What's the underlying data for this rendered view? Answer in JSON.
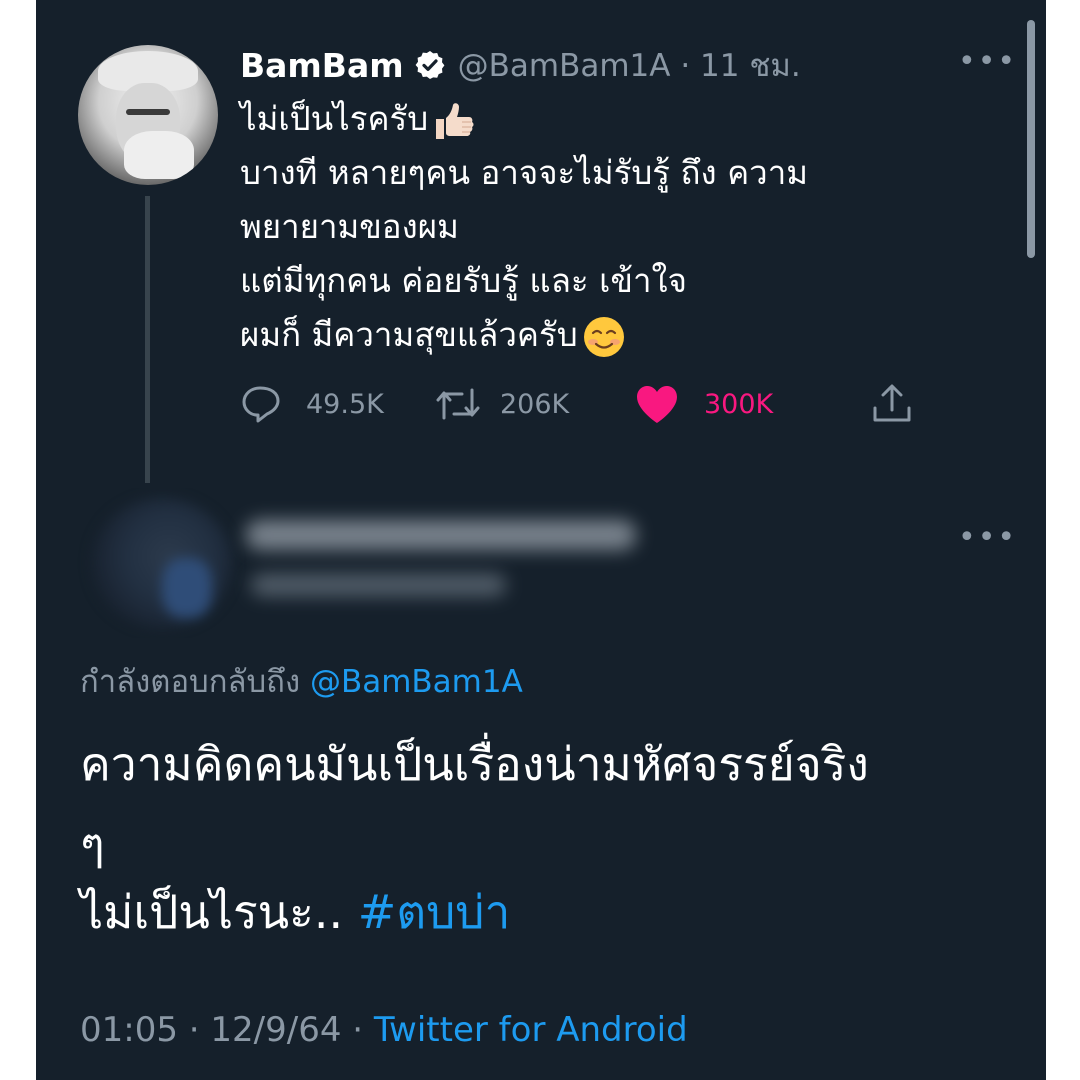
{
  "tweet": {
    "display_name": "BamBam",
    "handle_time": "@BamBam1A · 11 ชม.",
    "lines": [
      "ไม่เป็นไรครับ",
      "บางที หลายๆคน อาจจะไม่รับรู้ ถึง ความ",
      "พยายามของผม",
      "แต่มีทุกคน ค่อยรับรู้ และ เข้าใจ",
      "ผมก็ มีความสุขแล้วครับ"
    ],
    "emoji_1": "thumbs-up-emoji",
    "emoji_2": "smiling-face-emoji",
    "replies": "49.5K",
    "retweets": "206K",
    "likes": "300K",
    "liked": true
  },
  "reply": {
    "replying_prefix": "กำลังตอบกลับถึง",
    "replying_handle": "@BamBam1A",
    "line_1": "ความคิดคนมันเป็นเรื่องน่ามหัศจรรย์จริง",
    "line_2": "ๆ",
    "line_3_text": "ไม่เป็นไรนะ..",
    "hashtag": "#ตบบ่า",
    "time": "01:05 · 12/9/64 ·",
    "source": "Twitter for Android"
  },
  "colors": {
    "background": "#15202b",
    "text": "#ffffff",
    "secondary": "#8b98a5",
    "accent": "#1d9bf0",
    "like": "#f91880"
  },
  "more_label": "•••"
}
